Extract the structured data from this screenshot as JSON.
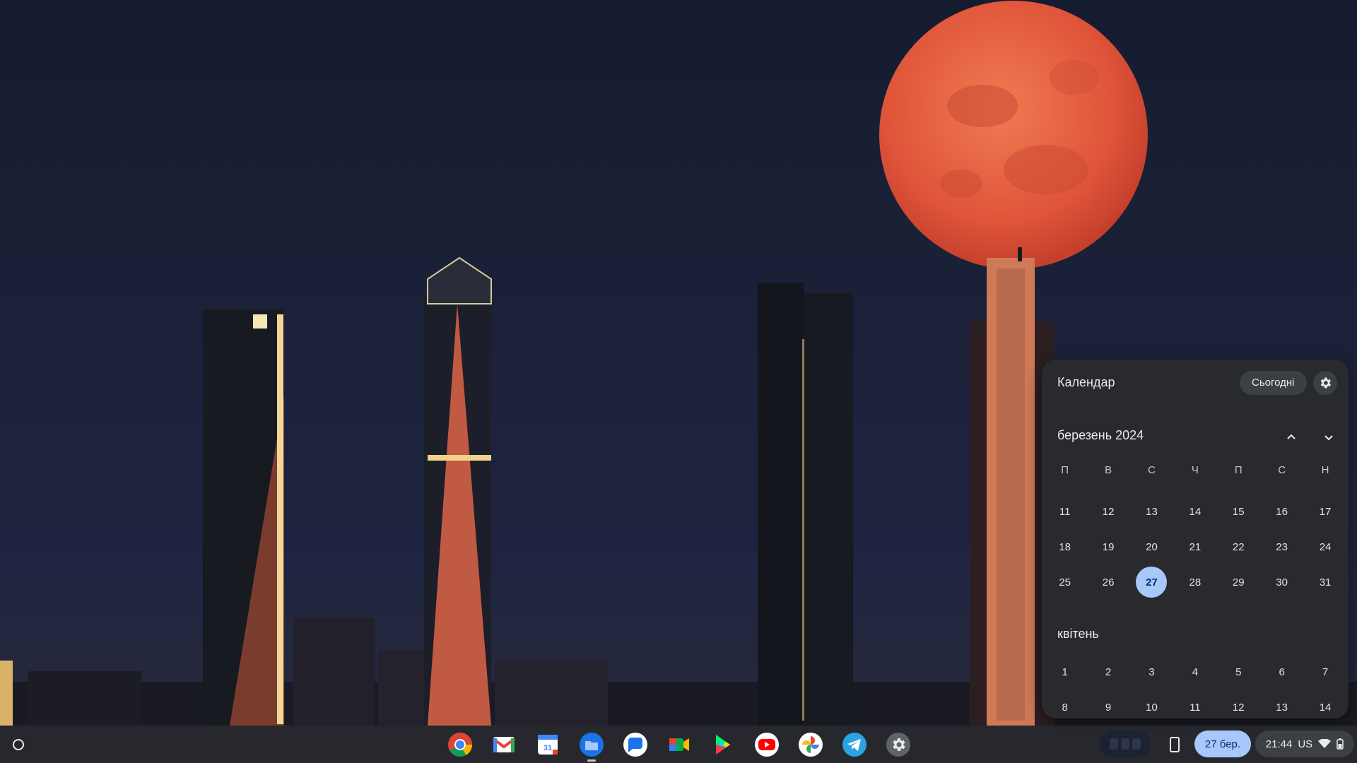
{
  "calendar": {
    "title": "Календар",
    "today_button": "Сьогодні",
    "month_label": "березень 2024",
    "weekdays": [
      "П",
      "В",
      "С",
      "Ч",
      "П",
      "С",
      "Н"
    ],
    "march_weeks": [
      [
        "11",
        "12",
        "13",
        "14",
        "15",
        "16",
        "17"
      ],
      [
        "18",
        "19",
        "20",
        "21",
        "22",
        "23",
        "24"
      ],
      [
        "25",
        "26",
        "27",
        "28",
        "29",
        "30",
        "31"
      ]
    ],
    "next_month_label": "квітень",
    "april_weeks": [
      [
        "1",
        "2",
        "3",
        "4",
        "5",
        "6",
        "7"
      ],
      [
        "8",
        "9",
        "10",
        "11",
        "12",
        "13",
        "14"
      ]
    ],
    "today": "27"
  },
  "shelf": {
    "apps": [
      "chrome",
      "gmail",
      "calendar",
      "files",
      "messages",
      "meet",
      "play-store",
      "youtube",
      "photos",
      "telegram",
      "settings"
    ],
    "calendar_icon_text": "31",
    "date_pill": "27 бер.",
    "time": "21:44",
    "input_method": "US"
  },
  "colors": {
    "accent": "#a8c7fa",
    "popup_bg": "#282a2d",
    "moon": "#e4553b"
  }
}
